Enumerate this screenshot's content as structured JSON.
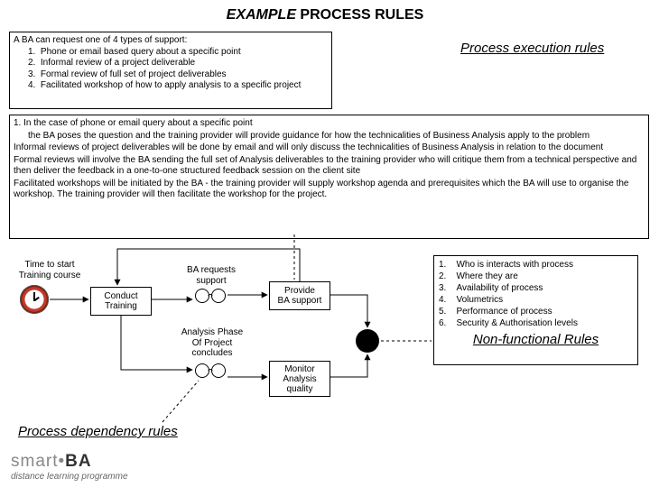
{
  "title_emph": "EXAMPLE",
  "title_rest": " PROCESS RULES",
  "execution_label": "Process execution rules",
  "dependency_label": "Process dependency rules",
  "nonfunctional_label": "Non-functional Rules",
  "box1_intro": "A BA can request one of 4 types of support:",
  "box1_items": {
    "1": "Phone or email based query about a specific point",
    "2": "Informal review of a project deliverable",
    "3": "Formal review of full set of project deliverables",
    "4": "Facilitated workshop of how to apply analysis to a specific project"
  },
  "box2_line1a": "1. In the case of phone or email query about a specific point",
  "box2_line1b": "the BA poses the question and the training provider will provide guidance for how the technicalities of Business Analysis apply to the problem",
  "box2_line2": "Informal reviews of project deliverables will be done by email and will only discuss the technicalities of Business Analysis in relation to the document",
  "box2_line3": "Formal reviews will involve the BA sending the full set of Analysis deliverables to the training provider who will critique them from a technical perspective and then deliver the feedback in a one-to-one structured feedback session on the client site",
  "box2_line4": "Facilitated workshops will be initiated by the BA - the training provider will supply workshop agenda and prerequisites which the BA will use to organise the workshop. The training provider will then facilitate the workshop for the project.",
  "nf_items": {
    "1": "Who is interacts with process",
    "2": "Where they are",
    "3": "Availability of process",
    "4": "Volumetrics",
    "5": "Performance of process",
    "6": "Security & Authorisation levels"
  },
  "diagram": {
    "start_event": "Time to start\nTraining course",
    "conduct_training": "Conduct\nTraining",
    "ba_requests": "BA requests\nsupport",
    "provide_support": "Provide\nBA support",
    "analysis_concludes": "Analysis Phase\nOf Project\nconcludes",
    "monitor_quality": "Monitor\nAnalysis\nquality"
  },
  "logo_brand": "smart",
  "logo_dot": "•",
  "logo_ba": "BA",
  "logo_tag": "distance learning programme"
}
